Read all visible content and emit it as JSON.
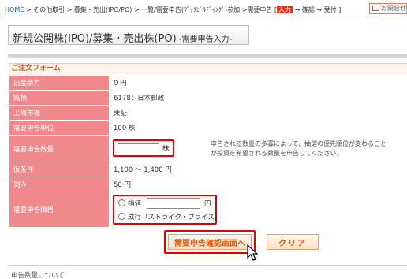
{
  "breadcrumb": {
    "home": "HOME",
    "trail": " > その他取引 > 募集・売出(IPO/PO) > 一覧/需要申告(ﾌﾞｯｸﾋﾞﾙﾃﾞｨﾝｸﾞ)参加 >需要申告 [",
    "current": "入力",
    "rest": " → 確認 → 受付 ]"
  },
  "header": {
    "inquiry_label": "お問合せ"
  },
  "page": {
    "title_main": "新規公開株(IPO)/募集・売出株(PO)",
    "title_sub": " -需要申告入力-"
  },
  "form": {
    "section_title": "ご注文フォーム",
    "rows": [
      {
        "label": "出金余力",
        "value": "0 円"
      },
      {
        "label": "銘柄",
        "value": "6178：日本郵政"
      },
      {
        "label": "上場市場",
        "value": "東証"
      },
      {
        "label": "需要申告単位",
        "value": "100 株"
      },
      {
        "label": "需要申告数量",
        "value": ""
      },
      {
        "label": "仮条件",
        "value": "1,100 〜 1,400 円"
      },
      {
        "label": "刻み",
        "value": "50 円"
      },
      {
        "label": "需要申告価格",
        "value": ""
      }
    ],
    "quantity": {
      "value": "",
      "unit": "株"
    },
    "quantity_note_line1": "申告される数量の多寡によって、抽選の優先順位が変わること",
    "quantity_note_line2": "が投資を希望される数量を申告してください。",
    "price": {
      "limit_label": "指値",
      "limit_value": "",
      "unit": "円",
      "market_label": "成行（ストライク・プライス）"
    }
  },
  "buttons": {
    "confirm_label": "需要申告確認画面へ",
    "clear_label": "クリア"
  },
  "footer": {
    "text": "申告数量について"
  },
  "colors": {
    "label_bg": "#f0898c",
    "highlight": "#e10000",
    "accent": "#e05a28"
  }
}
